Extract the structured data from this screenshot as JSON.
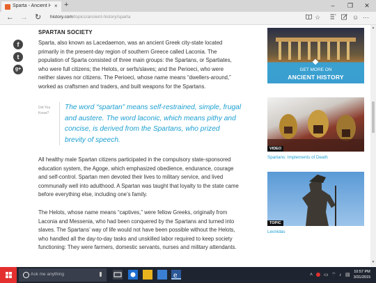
{
  "browser": {
    "tab_title": "Sparta - Ancient History...",
    "tab_close": "×",
    "new_tab": "+",
    "window_controls": {
      "minimize": "–",
      "maximize": "❐",
      "close": "✕"
    },
    "nav": {
      "back": "←",
      "forward": "→",
      "refresh": "↻"
    },
    "url_host": "history.com",
    "url_path": "/topics/ancient-history/sparta",
    "tool_icons": [
      "reading-view-icon",
      "favorite-star-icon",
      "hub-icon",
      "web-note-icon",
      "share-icon",
      "more-icon"
    ]
  },
  "share_buttons": [
    {
      "name": "facebook",
      "glyph": "f"
    },
    {
      "name": "twitter",
      "glyph": "t"
    },
    {
      "name": "google-plus",
      "glyph": "g+"
    }
  ],
  "article": {
    "heading": "SPARTAN SOCIETY",
    "paragraph_1": "Sparta, also known as Lacedaemon, was an ancient Greek city-state located primarily in the present-day region of southern Greece called Laconia. The population of Sparta consisted of three main groups: the Spartans, or Spartiates, who were full citizens; the Helots, or serfs/slaves; and the Perioeci, who were neither slaves nor citizens. The Perioeci, whose name means “dwellers-around,” worked as craftsmen and traders, and built weapons for the Spartans.",
    "did_you_know": "Did You Know?",
    "quote": "The word “spartan” means self-restrained, simple, frugal and austere. The word laconic, which means pithy and concise, is derived from the Spartans, who prized brevity of speech.",
    "paragraph_2": "All healthy male Spartan citizens participated in the compulsory state-sponsored education system, the Agoge, which emphasized obedience, endurance, courage and self-control. Spartan men devoted their lives to military service, and lived communally well into adulthood. A Spartan was taught that loyalty to the state came before everything else, including one’s family.",
    "paragraph_3": "The Helots, whose name means “captives,” were fellow Greeks, originally from Laconia and Messenia, who had been conquered by the Spartans and turned into slaves. The Spartans’ way of life would not have been possible without the Helots, who handled all the day-to-day tasks and unskilled labor required to keep society functioning: They were farmers, domestic servants, nurses and military attendants."
  },
  "sidebar": {
    "ad_line1": "GET MORE ON",
    "ad_line2": "ANCIENT HISTORY",
    "video_badge": "VIDEO",
    "video_caption": "Spartans: Implements of Death",
    "topic_badge": "TOPIC",
    "topic_caption": "Leonidas"
  },
  "taskbar": {
    "search_placeholder": "Ask me anything",
    "time": "10:57 PM",
    "date": "3/31/2015"
  },
  "colors": {
    "accent": "#1a9fd1",
    "start": "#e42f2f",
    "taskbar": "#1f2530"
  }
}
